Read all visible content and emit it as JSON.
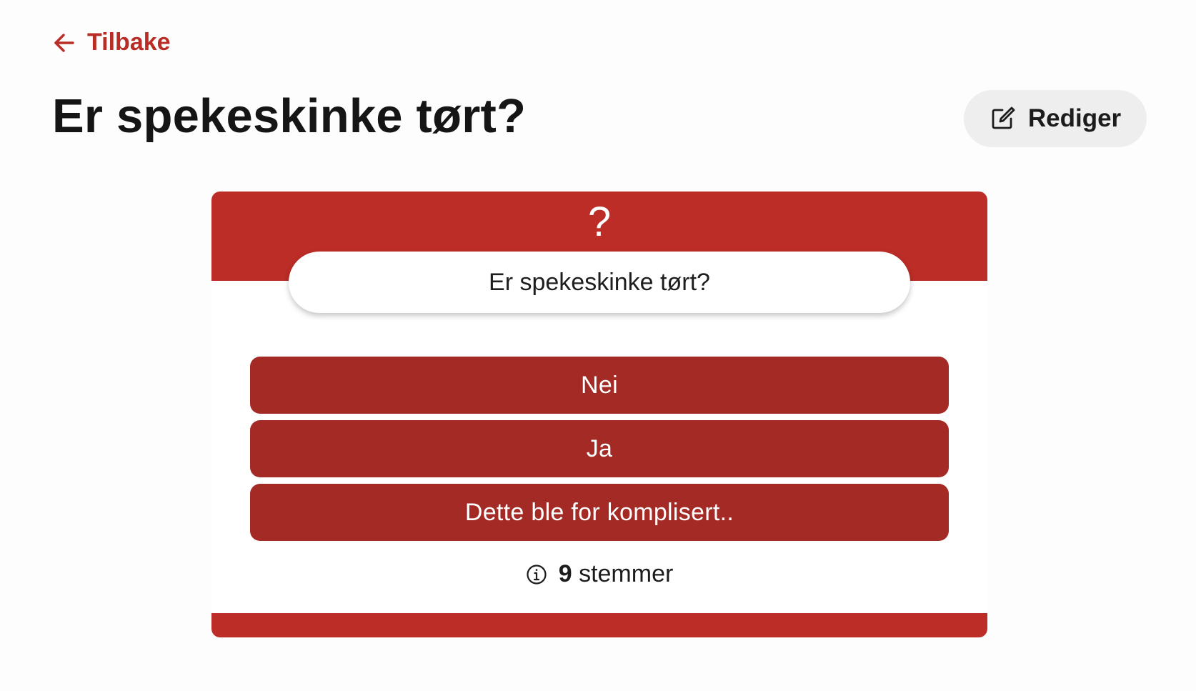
{
  "nav": {
    "back_label": "Tilbake",
    "back_icon": "arrow-left-icon"
  },
  "header": {
    "title": "Er spekeskinke tørt?",
    "edit_label": "Rediger",
    "edit_icon": "edit-icon"
  },
  "poll": {
    "header_symbol": "?",
    "question": "Er spekeskinke tørt?",
    "options": [
      {
        "label": "Nei"
      },
      {
        "label": "Ja"
      },
      {
        "label": "Dette ble for komplisert.."
      }
    ],
    "vote_count": "9",
    "vote_unit": "stemmer",
    "info_icon": "info-icon"
  },
  "colors": {
    "accent": "#bb2d26",
    "option_background": "#a42a25",
    "edit_button_background": "#eeeeee",
    "text": "#151515"
  }
}
